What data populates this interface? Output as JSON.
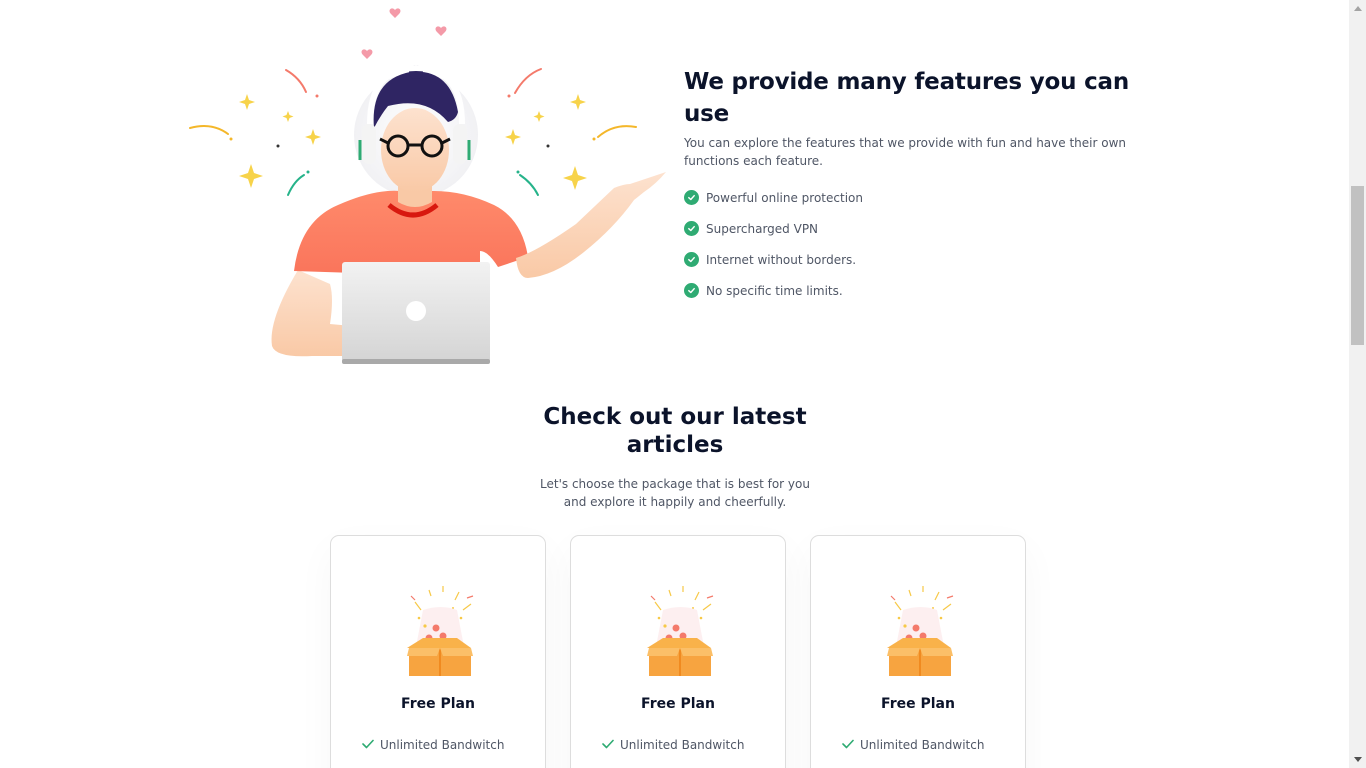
{
  "features": {
    "title": "We provide many features you can use",
    "description": "You can explore the features that we provide with fun and have their own functions each feature.",
    "items": [
      "Powerful online protection",
      "Supercharged VPN",
      "Internet without borders.",
      "No specific time limits."
    ]
  },
  "articles": {
    "title_line1": "Check out our latest",
    "title_line2": "articles",
    "subtitle_line1": "Let's choose the package that is best for you",
    "subtitle_line2": "and explore it happily and cheerfully."
  },
  "plans": [
    {
      "name": "Free Plan",
      "feature": "Unlimited Bandwitch"
    },
    {
      "name": "Free Plan",
      "feature": "Unlimited Bandwitch"
    },
    {
      "name": "Free Plan",
      "feature": "Unlimited Bandwitch"
    }
  ],
  "colors": {
    "accent_green": "#2fab73",
    "heading": "#0b132a",
    "body_text": "#4f5665",
    "shirt": "#f76c5e",
    "box_orange": "#f7a440"
  },
  "icons": {
    "feature_check": "check-circle-icon",
    "plan_check": "check-icon",
    "plan_art": "gift-box-icon"
  }
}
